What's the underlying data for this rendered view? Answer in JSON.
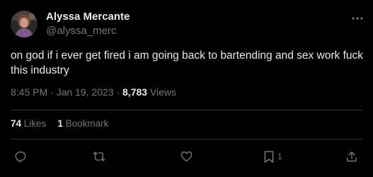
{
  "user": {
    "display_name": "Alyssa Mercante",
    "handle": "@alyssa_merc"
  },
  "tweet": {
    "text": "on god if i ever get fired i am going back to bartending and sex work fuck this industry",
    "time": "8:45 PM",
    "sep1": " · ",
    "date": "Jan 19, 2023",
    "sep2": " · ",
    "views_count": "8,783",
    "views_label": "Views"
  },
  "stats": {
    "likes_count": "74",
    "likes_label": "Likes",
    "bookmarks_count": "1",
    "bookmarks_label": "Bookmark"
  },
  "actions": {
    "reply_icon": "reply-icon",
    "retweet_icon": "retweet-icon",
    "like_icon": "heart-icon",
    "bookmark_icon": "bookmark-icon",
    "bookmark_count": "1",
    "share_icon": "share-icon"
  },
  "colors": {
    "background": "#000000",
    "text_primary": "#e7e9ea",
    "text_secondary": "#71767b",
    "divider": "#2f3336"
  }
}
